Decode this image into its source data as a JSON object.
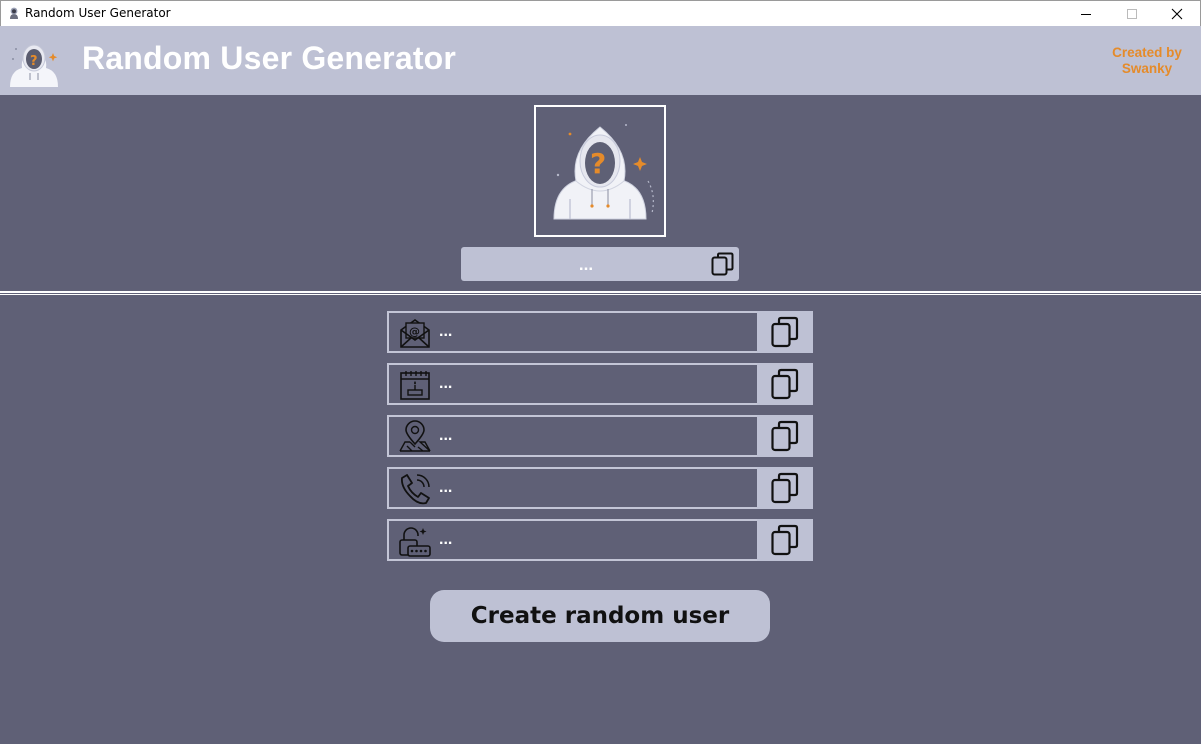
{
  "window": {
    "title": "Random User Generator",
    "controls": {
      "minimize": "minimize-icon",
      "maximize": "maximize-icon",
      "close": "close-icon"
    }
  },
  "header": {
    "title": "Random User Generator",
    "credit_line1": "Created by",
    "credit_line2": "Swanky",
    "logo": "hooded-user-icon"
  },
  "profile": {
    "avatar": "hooded-user-question-icon",
    "name": "..."
  },
  "fields": [
    {
      "key": "email",
      "icon": "email-icon",
      "value": "..."
    },
    {
      "key": "birthday",
      "icon": "calendar-cake-icon",
      "value": "..."
    },
    {
      "key": "location",
      "icon": "map-pin-icon",
      "value": "..."
    },
    {
      "key": "phone",
      "icon": "phone-icon",
      "value": "..."
    },
    {
      "key": "password",
      "icon": "password-lock-icon",
      "value": "..."
    }
  ],
  "actions": {
    "create_label": "Create random user"
  },
  "colors": {
    "background": "#5f6076",
    "panel": "#bec1d4",
    "accent": "#e58b2a",
    "text": "#ffffff"
  }
}
